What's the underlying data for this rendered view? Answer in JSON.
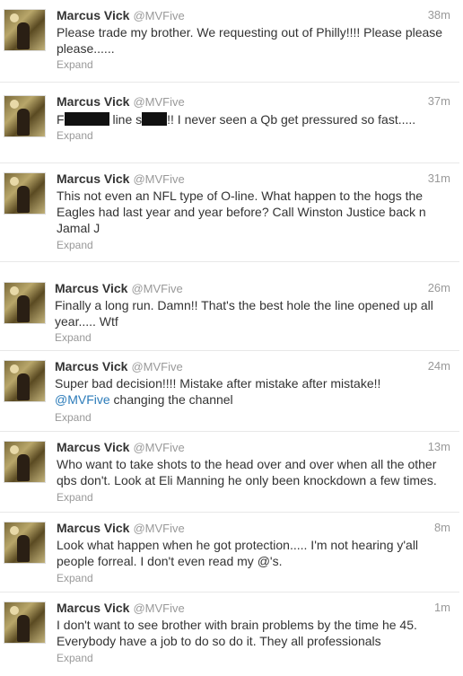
{
  "user": {
    "name": "Marcus Vick",
    "handle": "@MVFive"
  },
  "expand_label": "Expand",
  "tweets": [
    {
      "time": "38m",
      "text": "Please trade my brother. We requesting out of Philly!!!! Please please please......"
    },
    {
      "time": "37m",
      "text_a": "F",
      "text_b": " line s",
      "text_c": "!! I never seen a Qb get pressured so fast....."
    },
    {
      "time": "31m",
      "text": "This not even an NFL type of O-line. What happen to the hogs the Eagles had last year and year before? Call Winston Justice back n Jamal J"
    },
    {
      "time": "26m",
      "text": "Finally a long run. Damn!! That's the best hole the line opened up all year..... Wtf"
    },
    {
      "time": "24m",
      "text": "Super bad decision!!!! Mistake after mistake after mistake!!",
      "mention": "@MVFive",
      "text_after": " changing the channel"
    },
    {
      "time": "13m",
      "text": "Who want to take shots to the head over and over when all the other qbs don't. Look at Eli Manning he only been knockdown a few times."
    },
    {
      "time": "8m",
      "text": "Look what happen when he got protection..... I'm not hearing y'all people forreal. I don't even read my @'s."
    },
    {
      "time": "1m",
      "text": "I don't want to see brother with brain problems by the time he 45. Everybody have a job to do so do it. They all professionals"
    }
  ],
  "colors": {
    "name": "#333333",
    "meta": "#999999",
    "link": "#2b7bb9",
    "divider": "#e8e8e8"
  }
}
